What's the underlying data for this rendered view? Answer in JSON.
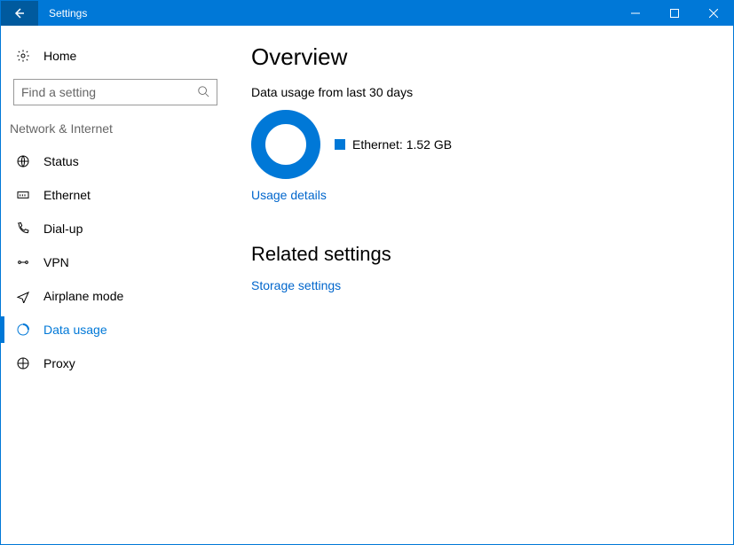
{
  "titlebar": {
    "title": "Settings"
  },
  "sidebar": {
    "home_label": "Home",
    "search_placeholder": "Find a setting",
    "section_label": "Network & Internet",
    "items": [
      {
        "label": "Status"
      },
      {
        "label": "Ethernet"
      },
      {
        "label": "Dial-up"
      },
      {
        "label": "VPN"
      },
      {
        "label": "Airplane mode"
      },
      {
        "label": "Data usage"
      },
      {
        "label": "Proxy"
      }
    ]
  },
  "main": {
    "heading": "Overview",
    "subtext": "Data usage from last 30 days",
    "legend_label": "Ethernet: 1.52 GB",
    "usage_details_link": "Usage details",
    "related_heading": "Related settings",
    "storage_link": "Storage settings"
  },
  "chart_data": {
    "type": "pie",
    "title": "Data usage from last 30 days",
    "series": [
      {
        "name": "Ethernet",
        "value_gb": 1.52,
        "color": "#0078d7"
      }
    ]
  }
}
